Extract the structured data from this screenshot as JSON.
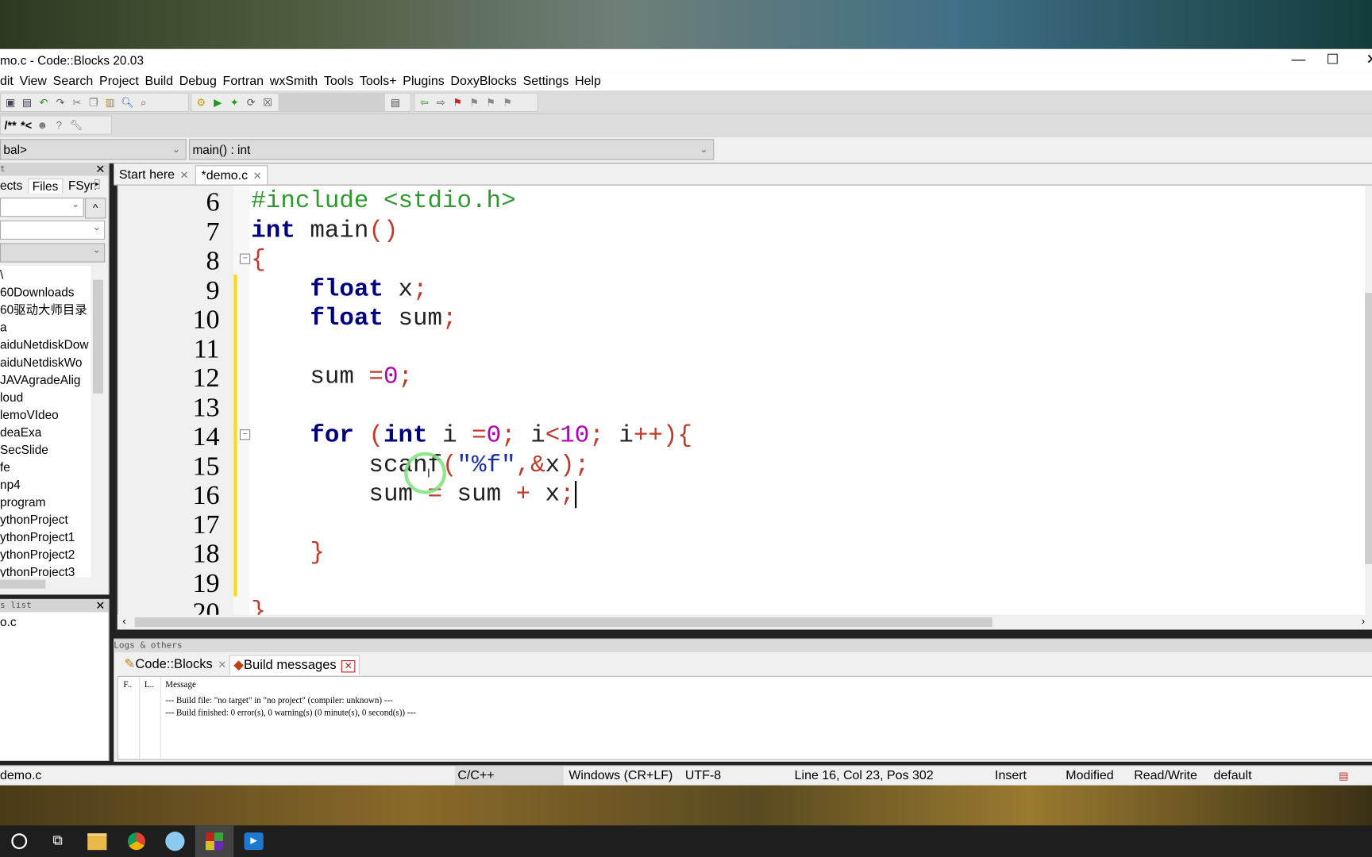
{
  "window": {
    "title": "mo.c - Code::Blocks 20.03",
    "minimize": "—",
    "maximize": "☐",
    "close": "✕"
  },
  "menu": [
    "dit",
    "View",
    "Search",
    "Project",
    "Build",
    "Debug",
    "Fortran",
    "wxSmith",
    "Tools",
    "Tools+",
    "Plugins",
    "DoxyBlocks",
    "Settings",
    "Help"
  ],
  "toolbar2": {
    "doxy_comment": "/**",
    "doxy_line": "*<"
  },
  "scope": {
    "left": "bal>",
    "right": "main() : int"
  },
  "management": {
    "header": "t",
    "tabs": [
      "ects",
      "Files",
      "FSyn"
    ],
    "files": [
      "\\",
      "60Downloads",
      "60驱动大师目录",
      "a",
      "aiduNetdiskDow",
      "aiduNetdiskWo",
      "JAVAgradeAlig",
      "loud",
      "lemoVIdeo",
      "deaExa",
      "SecSlide",
      "fe",
      "np4",
      "program",
      "ythonProject",
      "ythonProject1",
      "ythonProject2",
      "ythonProject3"
    ]
  },
  "open_files": {
    "header": "s list",
    "items": [
      "o.c"
    ]
  },
  "editor_tabs": [
    {
      "label": "Start here"
    },
    {
      "label": "*demo.c"
    }
  ],
  "code": {
    "line_numbers": [
      "6",
      "7",
      "8",
      "9",
      "10",
      "11",
      "12",
      "13",
      "14",
      "15",
      "16",
      "17",
      "18",
      "19",
      "20"
    ],
    "lines": [
      [
        [
          "pp",
          "#include <stdio.h>"
        ]
      ],
      [
        [
          "kw",
          "int"
        ],
        [
          "id",
          " main"
        ],
        [
          "op",
          "()"
        ]
      ],
      [
        [
          "op",
          "{"
        ]
      ],
      [
        [
          "id",
          "    "
        ],
        [
          "kw",
          "float"
        ],
        [
          "id",
          " x"
        ],
        [
          "op",
          ";"
        ]
      ],
      [
        [
          "id",
          "    "
        ],
        [
          "kw",
          "float"
        ],
        [
          "id",
          " sum"
        ],
        [
          "op",
          ";"
        ]
      ],
      [],
      [
        [
          "id",
          "    sum "
        ],
        [
          "op",
          "="
        ],
        [
          "num",
          "0"
        ],
        [
          "op",
          ";"
        ]
      ],
      [],
      [
        [
          "id",
          "    "
        ],
        [
          "kw",
          "for"
        ],
        [
          "id",
          " "
        ],
        [
          "op",
          "("
        ],
        [
          "kw",
          "int"
        ],
        [
          "id",
          " i "
        ],
        [
          "op",
          "="
        ],
        [
          "num",
          "0"
        ],
        [
          "op",
          ";"
        ],
        [
          "id",
          " i"
        ],
        [
          "op",
          "<"
        ],
        [
          "num",
          "10"
        ],
        [
          "op",
          ";"
        ],
        [
          "id",
          " i"
        ],
        [
          "op",
          "++){"
        ]
      ],
      [
        [
          "id",
          "        scanf"
        ],
        [
          "op",
          "("
        ],
        [
          "str",
          "\"%f\""
        ],
        [
          "op",
          ",&"
        ],
        [
          "id",
          "x"
        ],
        [
          "op",
          ");"
        ]
      ],
      [
        [
          "id",
          "        sum "
        ],
        [
          "op",
          "="
        ],
        [
          "id",
          " sum "
        ],
        [
          "op",
          "+"
        ],
        [
          "id",
          " x"
        ],
        [
          "op",
          ";"
        ]
      ],
      [],
      [
        [
          "id",
          "    "
        ],
        [
          "op",
          "}"
        ]
      ],
      [],
      [
        [
          "op",
          "}"
        ]
      ]
    ],
    "colors": {
      "pp": "#2e9a2e",
      "kw": "#00007f",
      "id": "#222222",
      "op": "#c0392b",
      "num": "#b000b0",
      "str": "#1c2fa0"
    }
  },
  "logs": {
    "header": "Logs & others",
    "tabs": [
      "Code::Blocks",
      "Build messages"
    ],
    "columns": [
      "F..",
      "L..",
      "Message"
    ],
    "messages": [
      "--- Build file: \"no target\" in \"no project\" (compiler: unknown) ---",
      "--- Build finished: 0 error(s), 0 warning(s) (0 minute(s), 0 second(s)) ---"
    ]
  },
  "status": {
    "file": "demo.c",
    "lang": "C/C++",
    "eol": "Windows (CR+LF)",
    "enc": "UTF-8",
    "pos": "Line 16, Col 23, Pos 302",
    "mode": "Insert",
    "modified": "Modified",
    "access": "Read/Write",
    "profile": "default"
  },
  "taskbar": [
    "search-icon",
    "task-view-icon",
    "file-explorer-icon",
    "chrome-icon",
    "app-icon",
    "codeblocks-icon",
    "video-app-icon"
  ]
}
